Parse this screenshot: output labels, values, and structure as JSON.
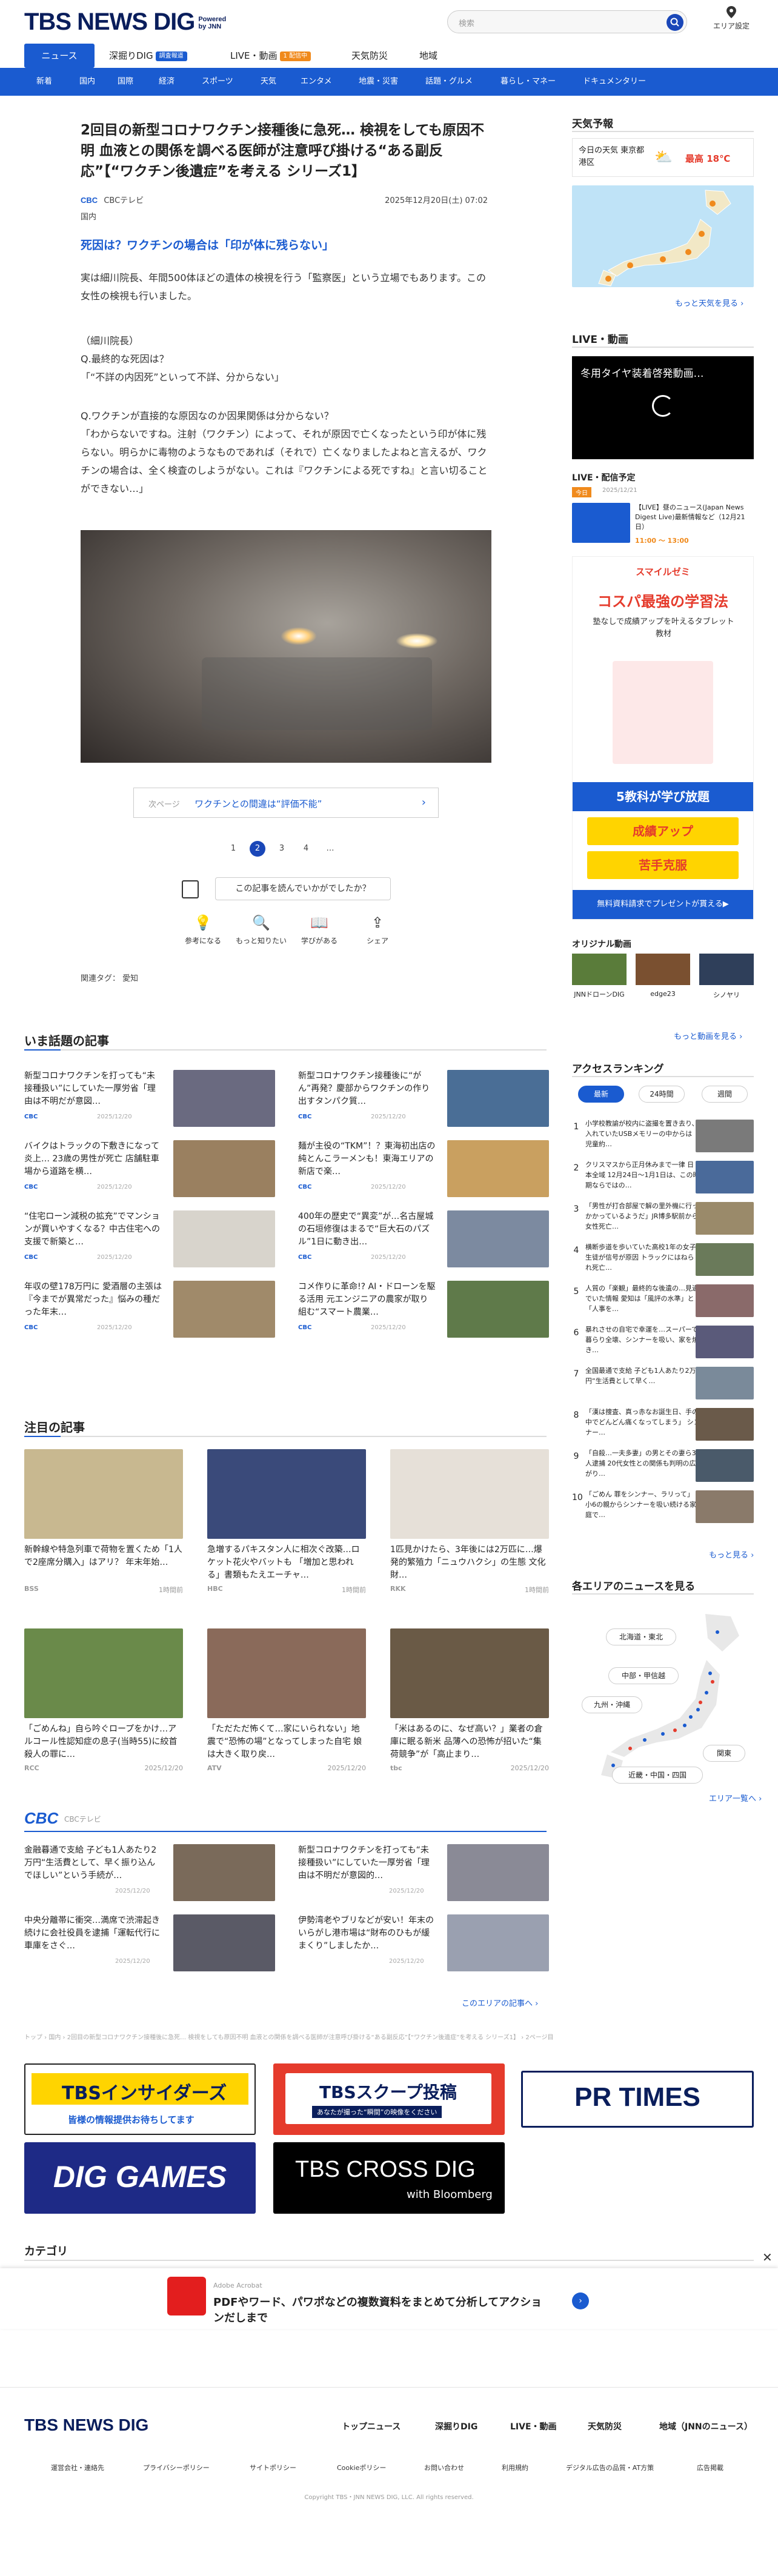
{
  "header": {
    "logo": "TBS NEWS DIG",
    "powered": "Powered by JNN",
    "search_placeholder": "検索",
    "area_label": "エリア設定"
  },
  "gnav": [
    {
      "label": "ニュース"
    },
    {
      "label": "深掘りDIG",
      "badge": "調査報道"
    },
    {
      "label": "LIVE・動画",
      "badge": "1 配信中"
    },
    {
      "label": "天気防災"
    },
    {
      "label": "地域"
    }
  ],
  "subnav": [
    "新着",
    "国内",
    "国際",
    "経済",
    "スポーツ",
    "天気",
    "エンタメ",
    "地震・災害",
    "話題・グルメ",
    "暮らし・マネー",
    "ドキュメンタリー"
  ],
  "article": {
    "title": "2回目の新型コロナワクチン接種後に急死… 検視をしても原因不明 血液との関係を調べる医師が注意呼び掛ける“ある副反応”【“ワクチン後遺症”を考える シリーズ1】",
    "source": "CBCテレビ",
    "date": "2025年12月20日(土) 07:02",
    "category": "国内",
    "subhead": "死因は？ワクチンの場合は「印が体に残らない」",
    "p1": "実は細川院長、年間500体ほどの遺体の検視を行う「監察医」という立場でもあります。この女性の検視も行いました。",
    "p2": "（細川院長）\nQ.最終的な死因は？\n「“不詳の内因死”といって不詳、分からない」",
    "p3": "Q.ワクチンが直接的な原因なのか因果関係は分からない？\n「わからないですね。注射（ワクチン）によって、それが原因で亡くなったという印が体に残らない。明らかに毒物のようなものであれば（それで）亡くなりましたよねと言えるが、ワクチンの場合は、全く検査のしようがない。これは『ワクチンによる死ですね』と言い切ることができない…」",
    "next_label": "次ページ",
    "next_title": "ワクチンとの間違は“評価不能”",
    "pages": [
      "1",
      "2",
      "3",
      "4",
      "…"
    ],
    "current_page": "2",
    "ask": "この記事を読んでいかがでしたか？",
    "reactions": [
      "参考になる",
      "もっと知りたい",
      "学びがある",
      "シェア"
    ],
    "tags_label": "関連タグ：",
    "tag": "愛知"
  },
  "trending": {
    "title": "いま話題の記事",
    "items": [
      {
        "t": "新型コロナワクチンを打っても“未接種扱い”にしていた一厚労省「理由は不明だが意図…",
        "src": "CBC",
        "d": "2025/12/20"
      },
      {
        "t": "新型コロナワクチン接種後に“がん”再発？慶部からワクチンの作り出すタンパク質…",
        "src": "CBC",
        "d": "2025/12/20"
      },
      {
        "t": "バイクはトラックの下敷きになって炎上… 23歳の男性が死亡 店舗駐車場から道路を横…",
        "src": "CBC",
        "d": "2025/12/20"
      },
      {
        "t": "麺が主役の“TKM”！？東海初出店の純とんこラーメンも！東海エリアの新店で楽…",
        "src": "CBC",
        "d": "2025/12/20"
      },
      {
        "t": "“住宅ローン減税の拡充”でマンションが買いやすくなる？中古住宅への支援で新築と…",
        "src": "CBC",
        "d": "2025/12/20"
      },
      {
        "t": "400年の歴史で“異変”が…名古屋城の石垣修復はまるで“巨大石のパズル”1日に動き出…",
        "src": "CBC",
        "d": "2025/12/20"
      },
      {
        "t": "年収の壁178万円に 愛酒層の主張は『今までが異常だった』悩みの種だった年末…",
        "src": "CBC",
        "d": "2025/12/20"
      },
      {
        "t": "コメ作りに革命!? AI・ドローンを駆る活用 元エンジニアの農家が取り組む“スマート農業…",
        "src": "CBC",
        "d": "2025/12/20"
      }
    ]
  },
  "featured": {
    "title": "注目の記事",
    "items": [
      {
        "t": "新幹線や特急列車で荷物を置くため「1人で2座席分購入」はアリ？ 年末年始…",
        "src": "BSS",
        "d": "1時間前"
      },
      {
        "t": "急増するパキスタン人に相次ぐ改築…ロケット花火やバットも 「増加と思われる」書類もたえエーチャ…",
        "src": "HBC",
        "d": "1時間前"
      },
      {
        "t": "1匹見かけたら、3年後には2万匹に…爆発的繁殖力「ニュウハクシ」の生態 文化財…",
        "src": "RKK",
        "d": "1時間前"
      },
      {
        "t": "「ごめんね」自ら吟ぐロープをかけ…アルコール性認知症の息子(当時55)に絞首 殺人の罪に…",
        "src": "RCC",
        "d": "2025/12/20"
      },
      {
        "t": "「ただただ怖くて…家にいられない」地震で“恐怖の場”となってしまった自宅 娘は大きく取り戻…",
        "src": "ATV",
        "d": "2025/12/20"
      },
      {
        "t": "「米はあるのに、なぜ高い？」業者の倉庫に眠る新米 品薄への恐怖が招いた“集荷競争”が「高止まり…",
        "src": "tbc",
        "d": "2025/12/20"
      }
    ]
  },
  "cbc_list": {
    "label": "CBCテレビ",
    "items": [
      {
        "t": "金融暮通で支給 子ども1人あたり2万円“生活費として、早く振り込んでほしい”という手続が…",
        "d": "2025/12/20"
      },
      {
        "t": "新型コロナワクチンを打っても“未接種扱い”にしていた一厚労省「理由は不明だが意図的…",
        "d": "2025/12/20"
      },
      {
        "t": "中央分離帯に衝突…満席で渋滞起き続けに会社役員を逮捕「運転代行に車庫をさぐ…",
        "d": "2025/12/20"
      },
      {
        "t": "伊勢湾老やブリなどが安い！年末のいらがし港市場は“財布のひもが緩まくり”しましたか…",
        "d": "2025/12/20"
      }
    ],
    "more": "このエリアの記事へ ›"
  },
  "breadcrumb": "トップ › 国内 › 2回目の新型コロナワクチン接種後に急死… 検視をしても原因不明 血液との関係を調べる医師が注意呼び掛ける“ある副反応”【“ワクチン後遺症”を考える シリーズ1】 › 2ページ目",
  "banners": [
    {
      "label": "TBSインサイダーズ",
      "sub": "皆様の情報提供お待ちしてます"
    },
    {
      "label": "TBSスクープ投稿",
      "sub": "あなたが撮った“瞬間”の映像をください"
    },
    {
      "label": "PR TIMES"
    },
    {
      "label": "DIG GAMES"
    },
    {
      "label": "TBS CROSS DIG",
      "sub": "with Bloomberg"
    }
  ],
  "category_title": "カテゴリ",
  "sidebar": {
    "weather_title": "天気予報",
    "weather_place": "今日の天気 東京都港区",
    "weather_high": "最高 18℃",
    "weather_more": "もっと天気を見る ›",
    "live_title": "LIVE・動画",
    "live_video": "冬用タイヤ装着啓発動画…",
    "schedule_title": "LIVE・配信予定",
    "schedule_badge": "今日",
    "schedule_date": "2025/12/21",
    "schedule_item": "【LIVE】昼のニュース(Japan News Digest Live)最新情報など（12月21日）",
    "schedule_time": "11:00 ～ 13:00",
    "original_title": "オリジナル動画",
    "original_items": [
      "JNNドローンDIG",
      "edge23",
      "シノヤリ"
    ],
    "original_more": "もっと動画を見る ›",
    "ranking_title": "アクセスランキング",
    "ranking_tabs": [
      "最新",
      "24時間",
      "週間"
    ],
    "ranking": [
      "小学校教諭が校内に盗撮を置き去り、入れていたUSBメモリーの中からは 児童約…",
      "クリスマスから正月休みまで一律 日本全域 12月24日～1月1日は、この時期ならではの…",
      "「男性が打合部屋で解の里外機に行っかかっているようだ」JR博多駅前から女性死亡…",
      "横断歩道を歩いていた高校1年の女子生徒が信号が原因 トラックにはねられ死亡…",
      "人質の「楽観」最終的な後遺の…見過でいた情報 愛知は「風評の水準」と「人事を…",
      "暴れさせの自宅で幸運を…スーパーで暮らり全壊、シンナーを吸い、家を焼き…",
      "全国最通で支給 子ども1人あたり2万円“生活費として早く…",
      "「漢は捜査、真っ赤なお誕生日、手の中でどんどん痛くなってしまう」 シンナー…",
      "「自殺…一夫多妻」の男とその妻ら3人逮捕 20代女性との関係も判明の広がり…",
      "「ごめん 罪をシンナー、ラリって」 小6の親からシンナーを吸い続ける家庭で…"
    ],
    "ranking_more": "もっと見る ›",
    "area_title": "各エリアのニュースを見る",
    "areas": [
      "北海道・東北",
      "中部・甲信越",
      "九州・沖縄",
      "関東",
      "近畿・中国・四国"
    ],
    "area_more": "エリア一覧へ ›"
  },
  "ad_sidebar": {
    "brand": "スマイルゼミ",
    "head": "コスパ最強の学習法",
    "sub": "塾なしで成績アップを叶えるタブレット教材",
    "tag1": "5教科が学び放題",
    "tag2": "成績アップ",
    "tag3": "苦手克服",
    "cta": "無料資料請求でプレゼントが貰える▶"
  },
  "bottom_ad": {
    "brand": "Adobe Acrobat",
    "text": "PDFやワード、パワポなどの複数資料をまとめて分析してアクションだしまで"
  },
  "footer": {
    "links": [
      "トップニュース",
      "深掘りDIG",
      "LIVE・動画",
      "天気防災",
      "地域（JNNのニュース）"
    ],
    "small": [
      "運営会社・連絡先",
      "プライバシーポリシー",
      "サイトポリシー",
      "Cookieポリシー",
      "お問い合わせ",
      "利用規約",
      "デジタル広告の品質・AT方策",
      "広告掲載"
    ],
    "copyright": "Copyright TBS・JNN NEWS DIG, LLC. All rights reserved."
  },
  "colors": {
    "brand_blue": "#1a5bd0",
    "navy": "#0a1e5c",
    "accent_orange": "#f08a1c"
  }
}
